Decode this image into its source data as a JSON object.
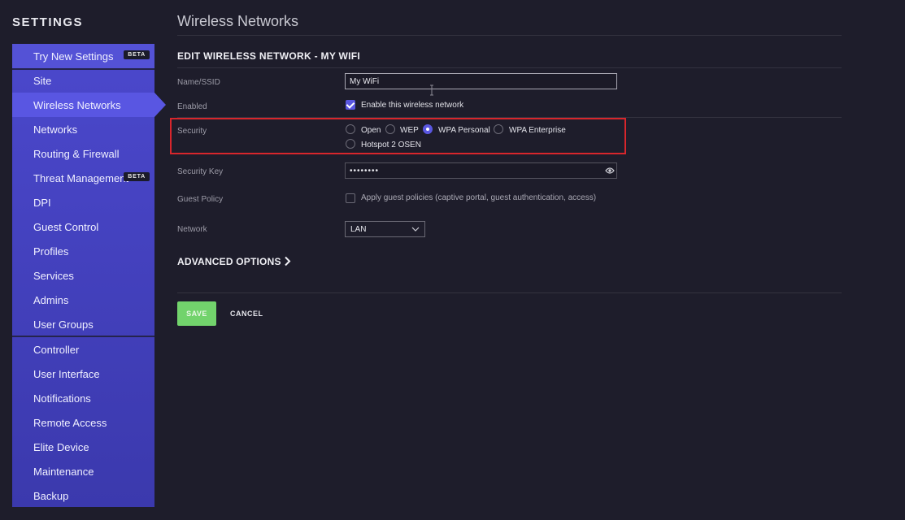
{
  "sidebar": {
    "heading": "SETTINGS",
    "try_new": {
      "label": "Try New Settings",
      "badge": "BETA"
    },
    "items": [
      {
        "label": "Site"
      },
      {
        "label": "Wireless Networks"
      },
      {
        "label": "Networks"
      },
      {
        "label": "Routing & Firewall"
      },
      {
        "label": "Threat Management",
        "badge": "BETA"
      },
      {
        "label": "DPI"
      },
      {
        "label": "Guest Control"
      },
      {
        "label": "Profiles"
      },
      {
        "label": "Services"
      },
      {
        "label": "Admins"
      },
      {
        "label": "User Groups"
      }
    ],
    "items2": [
      {
        "label": "Controller"
      },
      {
        "label": "User Interface"
      },
      {
        "label": "Notifications"
      },
      {
        "label": "Remote Access"
      },
      {
        "label": "Elite Device"
      },
      {
        "label": "Maintenance"
      },
      {
        "label": "Backup"
      }
    ],
    "active": "Wireless Networks"
  },
  "main": {
    "title": "Wireless Networks",
    "section_title": "EDIT WIRELESS NETWORK - MY WIFI",
    "name_label": "Name/SSID",
    "name_value": "My WiFi",
    "enabled_label": "Enabled",
    "enabled_checkbox": "Enable this wireless network",
    "enabled_checked": true,
    "security_label": "Security",
    "security_options": [
      "Open",
      "WEP",
      "WPA Personal",
      "WPA Enterprise",
      "Hotspot 2 OSEN"
    ],
    "security_selected": "WPA Personal",
    "security_key_label": "Security Key",
    "security_key_value": "••••••••",
    "guest_policy_label": "Guest Policy",
    "guest_policy_checkbox": "Apply guest policies (captive portal, guest authentication, access)",
    "guest_policy_checked": false,
    "network_label": "Network",
    "network_value": "LAN",
    "advanced_options": "ADVANCED OPTIONS",
    "save": "SAVE",
    "cancel": "CANCEL"
  },
  "colors": {
    "accent": "#5a57e0",
    "save_green": "#72d36c",
    "highlight_red": "#d8262c",
    "sidebar": "#4b48cc"
  }
}
